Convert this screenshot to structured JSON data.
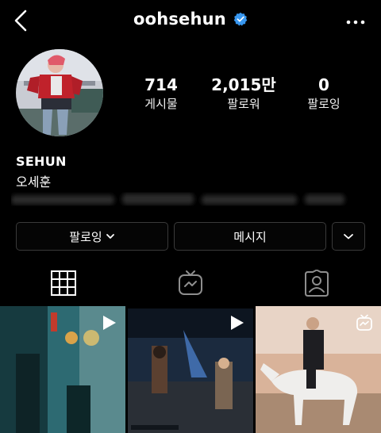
{
  "header": {
    "username": "oohsehun",
    "back_icon": "chevron-left-icon",
    "verified_icon": "verified-badge-icon",
    "more_icon": "more-horizontal-icon"
  },
  "profile": {
    "display_name": "SEHUN",
    "real_name": "오세훈"
  },
  "stats": {
    "posts": {
      "value": "714",
      "label": "게시물"
    },
    "followers": {
      "value": "2,015만",
      "label": "팔로워"
    },
    "following": {
      "value": "0",
      "label": "팔로잉"
    }
  },
  "actions": {
    "follow_label": "팔로잉",
    "message_label": "메시지"
  },
  "tabs": {
    "grid": "grid-icon",
    "igtv": "igtv-icon",
    "tagged": "tagged-person-icon"
  },
  "colors": {
    "background": "#000000",
    "text": "#ffffff",
    "button_border": "#3a3a3a",
    "verified": "#3897f0"
  }
}
